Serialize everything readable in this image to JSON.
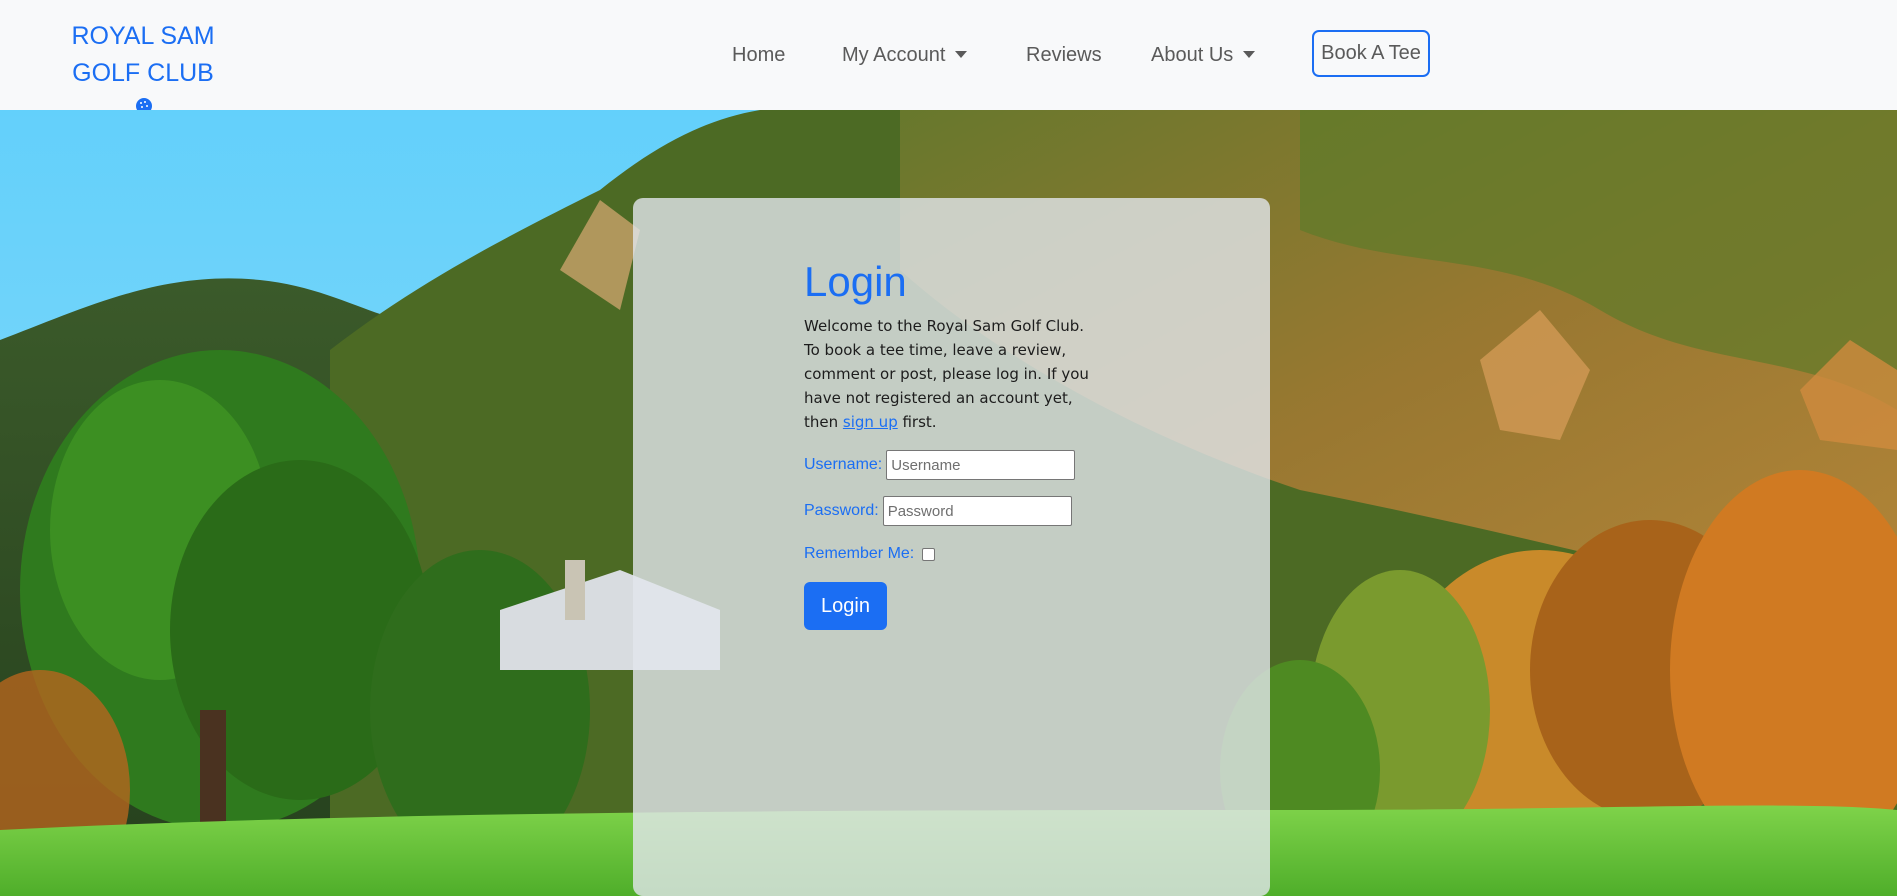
{
  "brand": {
    "line1": "ROYAL SAM",
    "line2": "GOLF CLUB"
  },
  "nav": {
    "home": "Home",
    "my_account": "My Account",
    "reviews": "Reviews",
    "about_us": "About Us",
    "book_a_tee": "Book A Tee"
  },
  "login": {
    "title": "Login",
    "intro_text": "Welcome to the Royal Sam Golf Club. To book a tee time, leave a review, comment or post, please log in. If you have not registered an account yet, then ",
    "signup_link": "sign up",
    "intro_tail": " first.",
    "username_label": "Username:",
    "username_placeholder": "Username",
    "username_value": "",
    "password_label": "Password:",
    "password_placeholder": "Password",
    "password_value": "",
    "remember_label": "Remember Me:",
    "remember_checked": false,
    "submit_label": "Login"
  },
  "colors": {
    "accent": "#1b6ef3",
    "nav_text": "#5a5a5a",
    "navbar_bg": "#f8f9fa"
  },
  "icons": {
    "brand_icon": "golf-ball-on-tee-icon",
    "dropdown": "caret-down-icon"
  }
}
